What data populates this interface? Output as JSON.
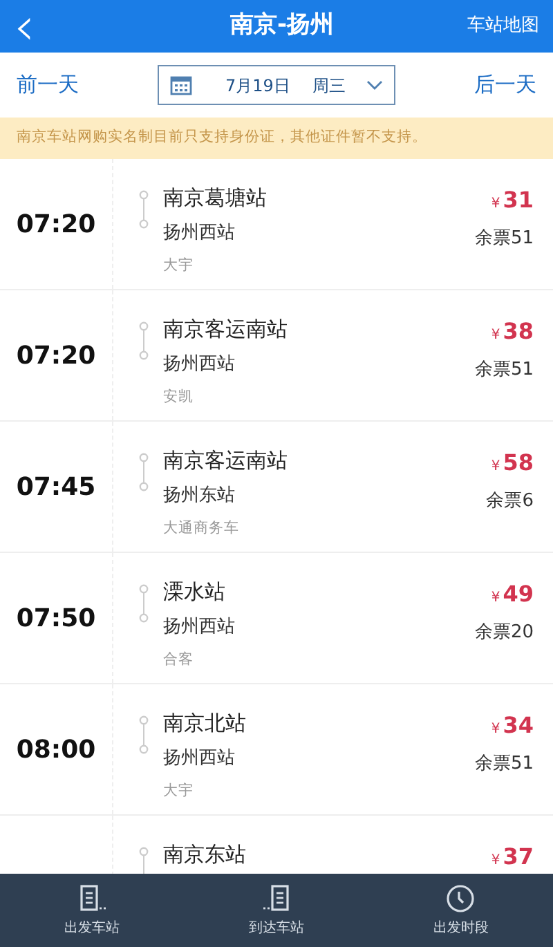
{
  "header": {
    "back": "‹",
    "title": "南京-扬州",
    "action": "车站地图"
  },
  "date_bar": {
    "prev": "前一天",
    "date": "7月19日",
    "weekday": "周三",
    "next": "后一天"
  },
  "notice": "南京车站网购实名制目前只支持身份证，其他证件暂不支持。",
  "trips": [
    {
      "time": "07:20",
      "from": "南京葛塘站",
      "to": "扬州西站",
      "operator": "大宇",
      "currency": "¥",
      "price": "31",
      "remaining": "余票51"
    },
    {
      "time": "07:20",
      "from": "南京客运南站",
      "to": "扬州西站",
      "operator": "安凯",
      "currency": "¥",
      "price": "38",
      "remaining": "余票51"
    },
    {
      "time": "07:45",
      "from": "南京客运南站",
      "to": "扬州东站",
      "operator": "大通商务车",
      "currency": "¥",
      "price": "58",
      "remaining": "余票6"
    },
    {
      "time": "07:50",
      "from": "溧水站",
      "to": "扬州西站",
      "operator": "合客",
      "currency": "¥",
      "price": "49",
      "remaining": "余票20"
    },
    {
      "time": "08:00",
      "from": "南京北站",
      "to": "扬州西站",
      "operator": "大宇",
      "currency": "¥",
      "price": "34",
      "remaining": "余票51"
    },
    {
      "from": "南京东站",
      "currency": "¥",
      "price": "37"
    }
  ],
  "tab_bar": [
    {
      "kind": "depart",
      "label": "出发车站"
    },
    {
      "kind": "arrive",
      "label": "到达车站"
    },
    {
      "kind": "time",
      "label": "出发时段"
    }
  ]
}
